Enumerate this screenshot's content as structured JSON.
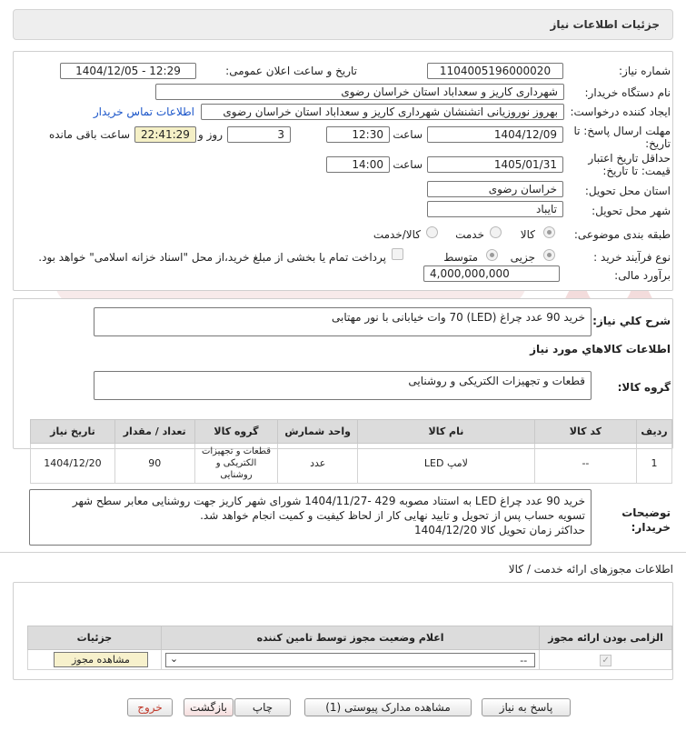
{
  "header": {
    "title": "جزئیات اطلاعات نیاز"
  },
  "fields": {
    "need_number_label": "شماره نیاز:",
    "need_number": "1104005196000020",
    "announce_label": "تاریخ و ساعت اعلان عمومی:",
    "announce_value": "1404/12/05 - 12:29",
    "buyer_label": "نام دستگاه خریدار:",
    "buyer_value": "شهرداری کاریز و سعداباد استان خراسان رضوی",
    "creator_label": "ایجاد کننده درخواست:",
    "creator_value": "بهروز نوروزیانی اتشنشان شهرداری کاریز و سعداباد استان خراسان رضوی",
    "contact_link": "اطلاعات تماس خریدار",
    "deadline_label_1": "مهلت ارسال پاسخ: تا",
    "deadline_label_2": "تاریخ:",
    "deadline_date": "1404/12/09",
    "time_label": "ساعت",
    "deadline_time": "12:30",
    "days_value": "3",
    "days_label": "روز و",
    "countdown": "22:41:29",
    "remaining_label": "ساعت باقی مانده",
    "validity_label_1": "حداقل تاریخ اعتبار",
    "validity_label_2": "قیمت: تا تاریخ:",
    "validity_date": "1405/01/31",
    "validity_time": "14:00",
    "province_label": "استان محل تحویل:",
    "province_value": "خراسان رضوی",
    "city_label": "شهر محل تحویل:",
    "city_value": "تایباد",
    "category_label": "طبقه بندی موضوعی:",
    "category_options": [
      "کالا",
      "خدمت",
      "کالا/خدمت"
    ],
    "process_label": "نوع فرآیند خرید :",
    "process_options": [
      "جزیی",
      "متوسط"
    ],
    "payment_note": "پرداخت تمام یا بخشی از مبلغ خرید،از محل \"اسناد خزانه اسلامی\" خواهد بود.",
    "budget_label": "برآورد مالی:",
    "budget_value": "4,000,000,000"
  },
  "summary": {
    "label": "شرح کلي نياز:",
    "value": "خرید 90 عدد چراغ (LED)  70 وات خیابانی با نور مهتابی"
  },
  "goods": {
    "section_title": "اطلاعات کالاهاي مورد نياز",
    "group_label": "گروه کالا:",
    "group_value": "قطعات و تجهیزات الکتریکی و روشنایی",
    "columns": [
      "رديف",
      "کد کالا",
      "نام کالا",
      "واحد شمارش",
      "گروه کالا",
      "تعداد / مقدار",
      "تاریخ نیاز"
    ],
    "rows": [
      {
        "index": "1",
        "code": "--",
        "name": "لامپ LED",
        "unit": "عدد",
        "group": "قطعات و تجهیزات الکتریکی و روشنایی",
        "qty": "90",
        "date": "1404/12/20"
      }
    ]
  },
  "notes": {
    "label_1": "توضیحات",
    "label_2": "خریدار:",
    "line_1": "خرید 90 عدد چراغ LED  به استناد مصوبه 429 -1404/11/27 شورای شهر کاریز جهت  روشنایی معابر سطح شهر",
    "line_2": "تسویه حساب پس از تحویل و تایید نهایی کار از لحاظ کیفیت و کمیت  انجام خواهد شد.",
    "line_3": "حداکثر زمان تحویل کالا 1404/12/20"
  },
  "permits": {
    "section_title": "اطلاعات مجوزهای ارائه خدمت / کالا",
    "columns": [
      "الزامی بودن ارائه مجوز",
      "اعلام وضعیت مجوز توسط تامین کننده",
      "جزئیات"
    ],
    "select_value": "--",
    "view_button": "مشاهده مجوز"
  },
  "buttons": {
    "respond": "پاسخ به نیاز",
    "attachments": "مشاهده مدارک پیوستی (1)",
    "print": "چاپ",
    "back": "بازگشت",
    "exit": "خروج"
  },
  "colors": {
    "header_bg": "#eeeeee",
    "countdown_bg": "#f5f0c6",
    "link": "#1a55c9",
    "exit_text": "#c0392b"
  }
}
